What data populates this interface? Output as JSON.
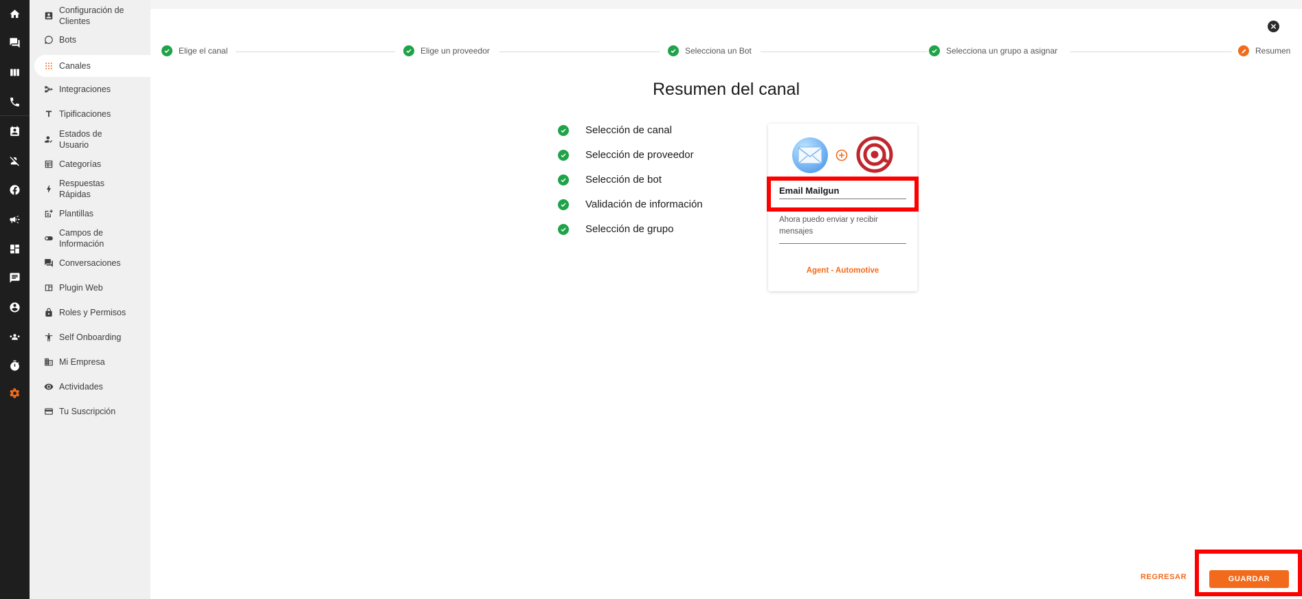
{
  "sidebar": {
    "items": [
      {
        "label": "Configuración de Clientes",
        "icon": "contact-card-icon"
      },
      {
        "label": "Bots",
        "icon": "bot-icon"
      },
      {
        "label": "Canales",
        "icon": "channels-icon",
        "active": true
      },
      {
        "label": "Integraciones",
        "icon": "integrations-icon"
      },
      {
        "label": "Tipificaciones",
        "icon": "text-t-icon"
      },
      {
        "label": "Estados de Usuario",
        "icon": "user-status-icon"
      },
      {
        "label": "Categorías",
        "icon": "table-icon"
      },
      {
        "label": "Respuestas Rápidas",
        "icon": "lightning-icon"
      },
      {
        "label": "Plantillas",
        "icon": "template-icon"
      },
      {
        "label": "Campos de Información",
        "icon": "toggle-icon"
      },
      {
        "label": "Conversaciones",
        "icon": "chat-icon"
      },
      {
        "label": "Plugin Web",
        "icon": "web-plugin-icon"
      },
      {
        "label": "Roles y Permisos",
        "icon": "lock-icon"
      },
      {
        "label": "Self Onboarding",
        "icon": "onboarding-icon"
      },
      {
        "label": "Mi Empresa",
        "icon": "building-icon"
      },
      {
        "label": "Actividades",
        "icon": "eye-icon"
      },
      {
        "label": "Tu Suscripción",
        "icon": "credit-card-icon"
      }
    ]
  },
  "rail": {
    "icons": [
      "home-icon",
      "chat-icon",
      "board-icon",
      "phone-icon",
      "contacts-icon",
      "user-off-icon",
      "facebook-icon",
      "megaphone-icon",
      "dashboard-icon",
      "notes-icon",
      "account-icon",
      "team-icon",
      "timer-icon",
      "settings-icon"
    ],
    "active": "settings-icon"
  },
  "stepper": {
    "steps": [
      {
        "label": "Elige el canal",
        "state": "done"
      },
      {
        "label": "Elige un proveedor",
        "state": "done"
      },
      {
        "label": "Selecciona un Bot",
        "state": "done"
      },
      {
        "label": "Selecciona un grupo a asignar",
        "state": "done"
      },
      {
        "label": "Resumen",
        "state": "current"
      }
    ]
  },
  "summary": {
    "title": "Resumen del canal",
    "checks": [
      "Selección de canal",
      "Selección de proveedor",
      "Selección de bot",
      "Validación de información",
      "Selección de grupo"
    ]
  },
  "card": {
    "name_value": "Email Mailgun",
    "description": "Ahora puedo enviar y recibir mensajes",
    "agent": "Agent - Automotive"
  },
  "actions": {
    "back_label": "REGRESAR",
    "save_label": "GUARDAR"
  },
  "colors": {
    "accent": "#f26b1d",
    "success": "#1fa349",
    "highlight": "#ff0000",
    "rail": "#1e1e1e"
  }
}
